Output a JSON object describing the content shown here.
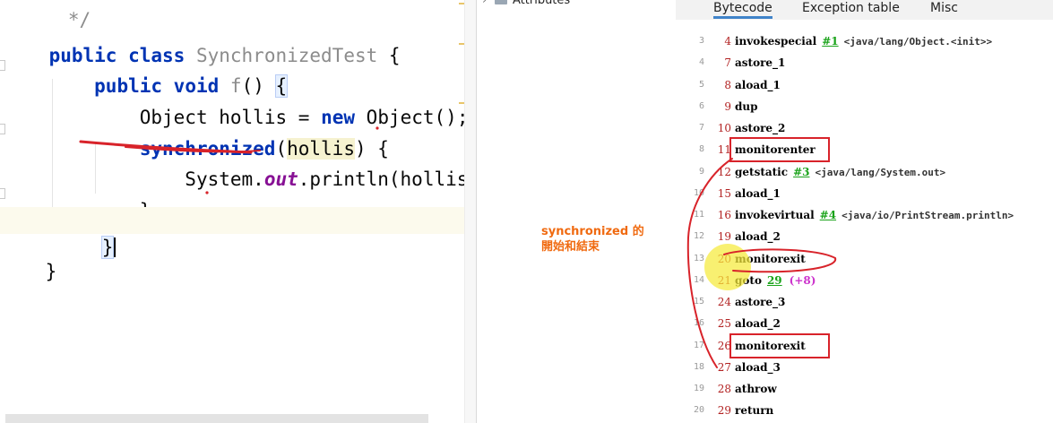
{
  "editor": {
    "lines": [
      {
        "frag": "  */"
      },
      {
        "kw1": "public",
        "kw2": "class",
        "name": "SynchronizedTest",
        "brace": "{"
      },
      {
        "kw1": "public",
        "kw2": "void",
        "name": "f",
        "parens": "()",
        "brace": "{"
      },
      {
        "type": "Object",
        "var": "hollis",
        "eq": "=",
        "kw": "new",
        "ctor": "Object();"
      },
      {
        "kw": "synchronized",
        "open": "(",
        "var": "hollis",
        "close": ")",
        "brace": "{"
      },
      {
        "cls": "System.",
        "field": "out",
        "rest": ".println(hollis);"
      },
      {
        "brace": "}"
      },
      {
        "brace": "}"
      },
      {
        "brace": "}"
      }
    ]
  },
  "structure": {
    "tree_item": "Attributes"
  },
  "bytecode": {
    "tabs": [
      "Bytecode",
      "Exception table",
      "Misc"
    ],
    "rows": [
      {
        "line": "3",
        "offset": "4",
        "op": "invokespecial",
        "ref": "#1",
        "comment": "<java/lang/Object.<init>>"
      },
      {
        "line": "4",
        "offset": "7",
        "op": "astore_1"
      },
      {
        "line": "5",
        "offset": "8",
        "op": "aload_1"
      },
      {
        "line": "6",
        "offset": "9",
        "op": "dup"
      },
      {
        "line": "7",
        "offset": "10",
        "op": "astore_2"
      },
      {
        "line": "8",
        "offset": "11",
        "op": "monitorenter"
      },
      {
        "line": "9",
        "offset": "12",
        "op": "getstatic",
        "ref": "#3",
        "comment": "<java/lang/System.out>"
      },
      {
        "line": "10",
        "offset": "15",
        "op": "aload_1"
      },
      {
        "line": "11",
        "offset": "16",
        "op": "invokevirtual",
        "ref": "#4",
        "comment": "<java/io/PrintStream.println>"
      },
      {
        "line": "12",
        "offset": "19",
        "op": "aload_2"
      },
      {
        "line": "13",
        "offset": "20",
        "op": "monitorexit"
      },
      {
        "line": "14",
        "offset": "21",
        "op": "goto",
        "ref": "29",
        "delta": "(+8)"
      },
      {
        "line": "15",
        "offset": "24",
        "op": "astore_3"
      },
      {
        "line": "16",
        "offset": "25",
        "op": "aload_2"
      },
      {
        "line": "17",
        "offset": "26",
        "op": "monitorexit"
      },
      {
        "line": "18",
        "offset": "27",
        "op": "aload_3"
      },
      {
        "line": "19",
        "offset": "28",
        "op": "athrow"
      },
      {
        "line": "20",
        "offset": "29",
        "op": "return"
      }
    ]
  },
  "annotation": {
    "line1": "synchronized 的",
    "line2": "開始和結束",
    "color": "#f06a10",
    "markup_color": "#d8232a",
    "highlight_color": "#f5ea3a"
  }
}
